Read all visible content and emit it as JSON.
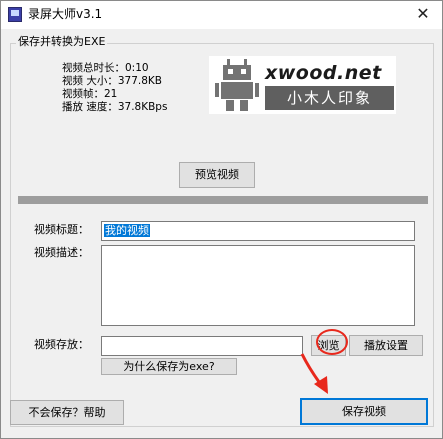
{
  "window": {
    "title": "录屏大师v3.1",
    "close_glyph": "✕"
  },
  "group": {
    "label": "保存并转换为EXE"
  },
  "video_info": {
    "duration": "视频总时长：0:10",
    "size": "视频 大小：377.8KB",
    "frames": "视频帧：21",
    "speed": "播放 速度：37.8KBps"
  },
  "logo": {
    "site": "xwood.net",
    "tagline": "小木人印象"
  },
  "buttons": {
    "preview": "预览视频",
    "browse": "浏览",
    "play_settings": "播放设置",
    "why_exe": "为什么保存为exe?",
    "help": "不会保存？帮助",
    "save": "保存视频"
  },
  "form": {
    "title_label": "视频标题：",
    "title_value": "我的视频",
    "desc_label": "视频描述：",
    "desc_value": "",
    "path_label": "视频存放：",
    "path_value": ""
  },
  "colors": {
    "selection": "#0078d7",
    "annotation": "#e8281c",
    "divider": "#9d9d9d"
  },
  "icons": [
    "app-icon",
    "close-icon",
    "robot-logo-icon",
    "annotation-arrow-icon"
  ]
}
